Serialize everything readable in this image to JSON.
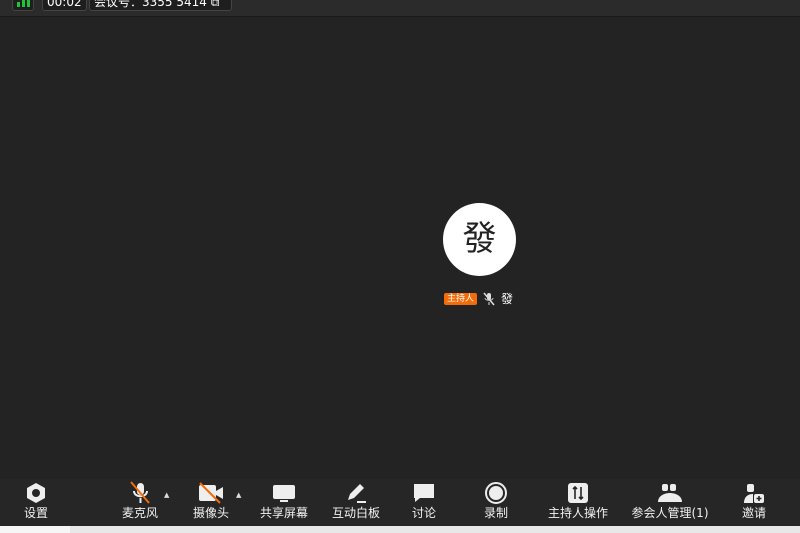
{
  "topbar": {
    "timer": "00:02",
    "meeting_id": "会议号：3355 5414"
  },
  "participant": {
    "avatar_char": "發",
    "host_badge": "主持人",
    "name": "發",
    "muted": true
  },
  "toolbar": {
    "settings": "设置",
    "mic": "麦克风",
    "camera": "摄像头",
    "share": "共享屏幕",
    "whiteboard": "互动白板",
    "chat": "讨论",
    "record": "录制",
    "host_ops": "主持人操作",
    "participants": "参会人管理(1)",
    "invite": "邀请"
  },
  "colors": {
    "accent": "#f26d0a",
    "signal": "#22c33a",
    "background": "#232323"
  }
}
